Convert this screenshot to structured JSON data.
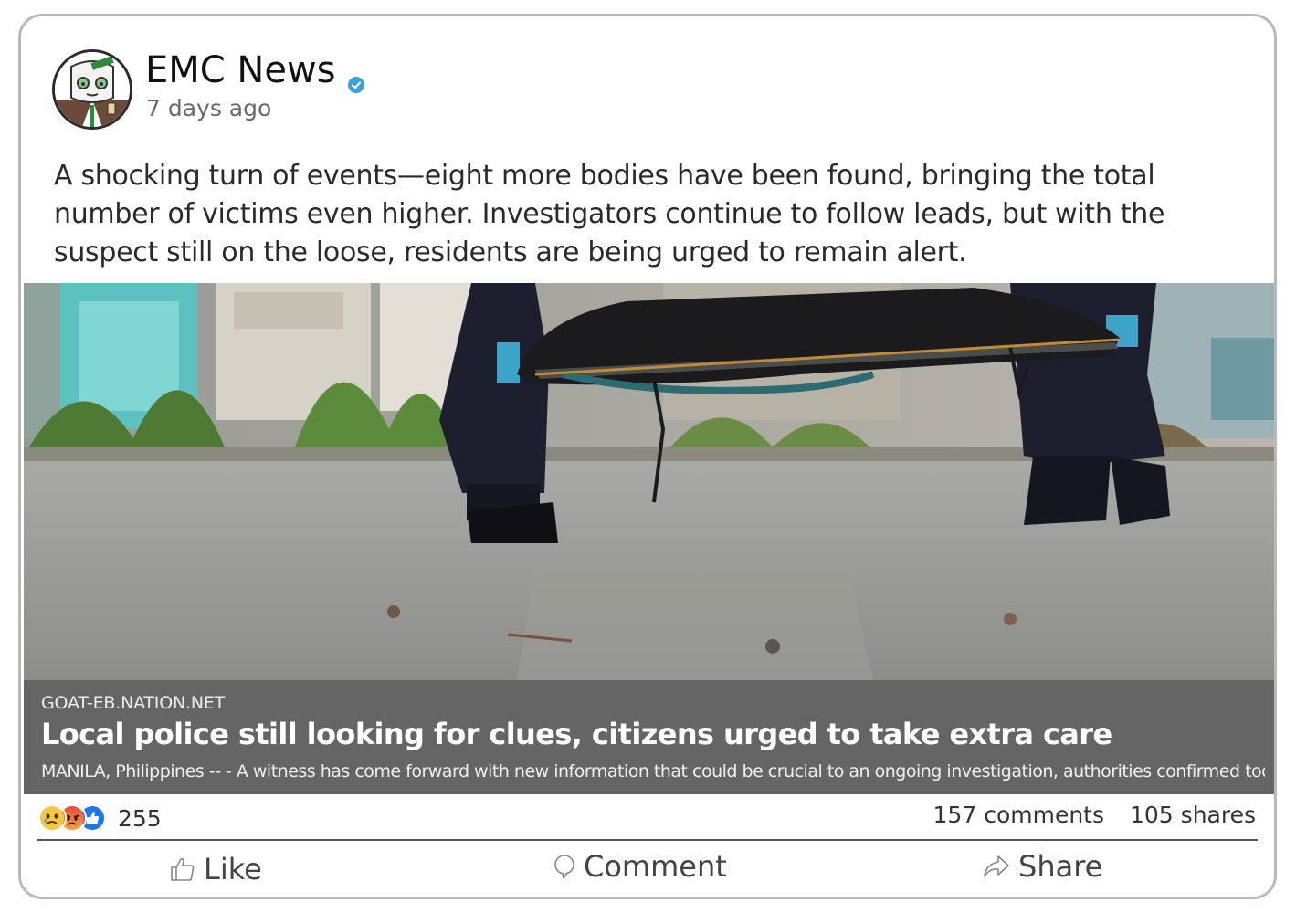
{
  "post": {
    "page_name": "EMC News",
    "timestamp": "7 days ago",
    "text": "A shocking turn of events—eight more bodies have been found, bringing the total number of victims even higher. Investigators continue to follow leads, but with the suspect still on the loose, residents are being urged to remain alert."
  },
  "link": {
    "domain": "GOAT-EB.NATION.NET",
    "title": "Local police still looking for clues, citizens urged to take extra care",
    "description": "MANILA, Philippines -- - A witness has come forward with new information that could be crucial to an ongoing investigation, authorities confirmed today..."
  },
  "engagement": {
    "reactions_count": "255",
    "comments": "157 comments",
    "shares": "105 shares",
    "reaction_icons": [
      "sad-icon",
      "angry-icon",
      "like-icon"
    ]
  },
  "actions": {
    "like": "Like",
    "comment": "Comment",
    "share": "Share"
  },
  "colors": {
    "verified": "#3b9fd9",
    "link_bar": "#656565",
    "like_blue": "#1877f2",
    "angry_orange": "#f0603a",
    "sad_yellow": "#f7c643"
  }
}
